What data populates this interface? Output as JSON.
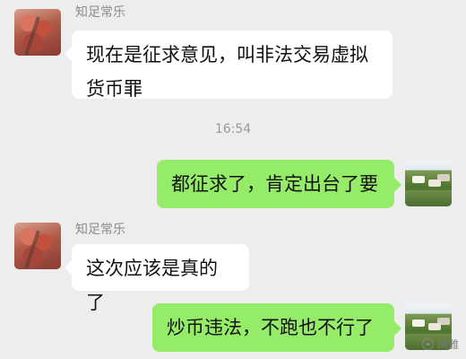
{
  "messages": [
    {
      "sender": "知足常乐",
      "text_line1": "现在是征求意见，叫非法交易虚拟",
      "text_line2": "货币罪"
    },
    {
      "time": "16:54"
    },
    {
      "text": "都征求了，肯定出台了要"
    },
    {
      "sender": "知足常乐",
      "text": "这次应该是真的了"
    },
    {
      "text": "炒币违法，不跑也不行了"
    }
  ],
  "watermark": {
    "label": "网雅"
  }
}
